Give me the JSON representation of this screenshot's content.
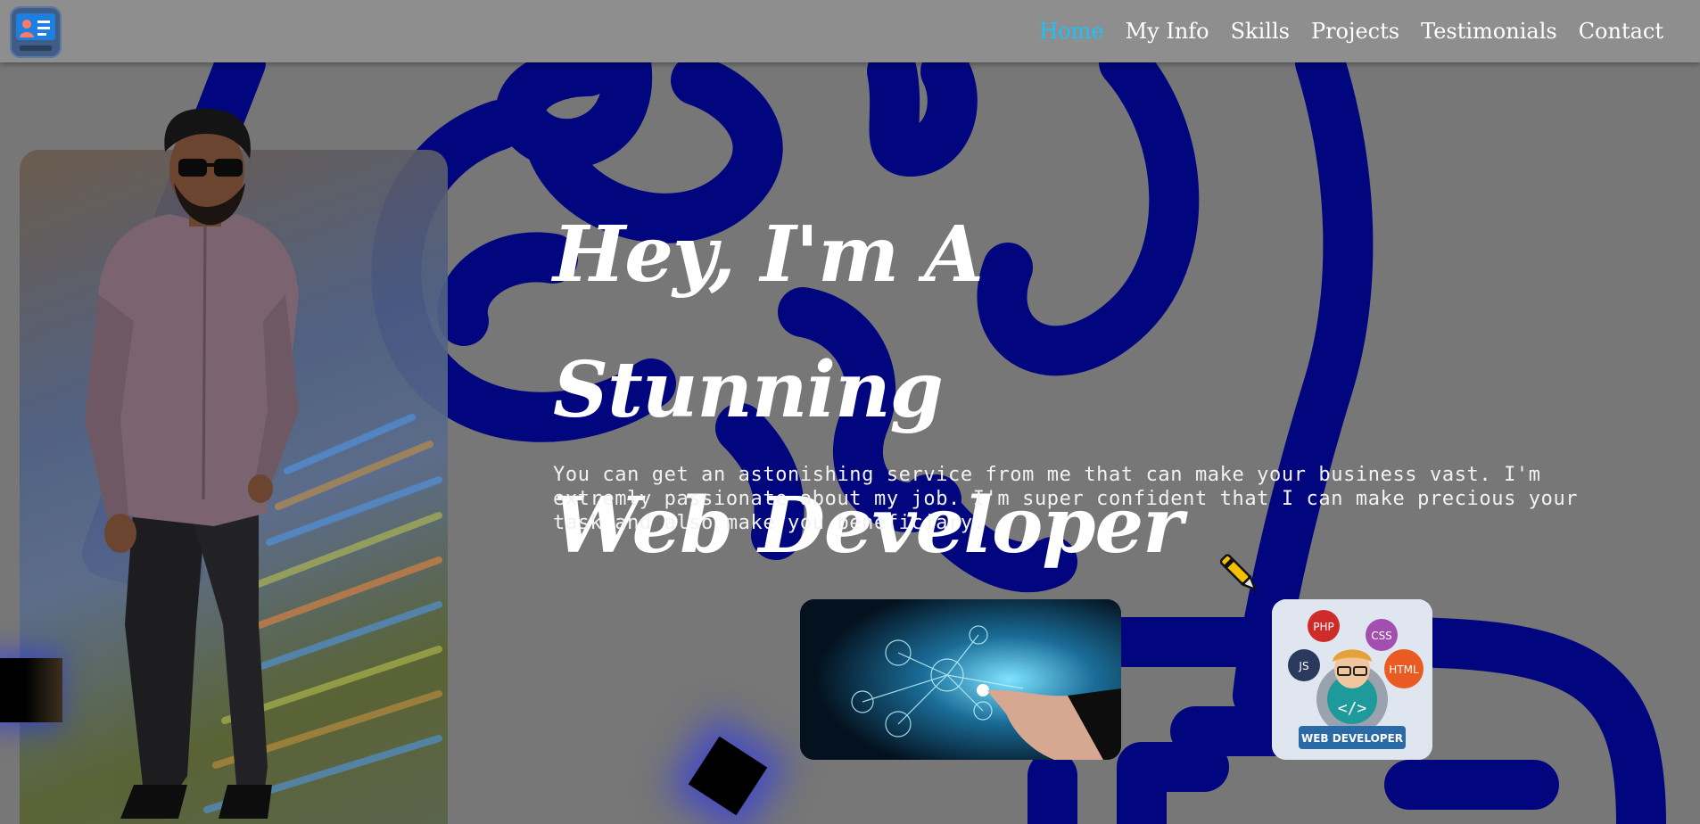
{
  "nav": {
    "logo_icon": "profile-card-icon",
    "links": [
      {
        "label": "Home",
        "active": true
      },
      {
        "label": "My Info",
        "active": false
      },
      {
        "label": "Skills",
        "active": false
      },
      {
        "label": "Projects",
        "active": false
      },
      {
        "label": "Testimonials",
        "active": false
      },
      {
        "label": "Contact",
        "active": false
      }
    ]
  },
  "hero": {
    "title_line1": "Hey, I'm A Stunning",
    "title_line2": "Web Developer",
    "title_icon": "pen-icon",
    "description": "You can get an astonishing service from me that can make your business vast. I'm extremly passionate about my job. I'm super confident that I can make precious your task and also make you beneficiary."
  },
  "images": {
    "network_image": "digital-network-hand-image",
    "webdev_badge": {
      "labels": [
        "PHP",
        "CSS",
        "JS",
        "HTML",
        "WEB DEVELOPER"
      ]
    }
  },
  "colors": {
    "accent": "#19c3ff",
    "background_stroke": "#02067e",
    "navbar": "#8e8e8e",
    "page": "#777777"
  }
}
